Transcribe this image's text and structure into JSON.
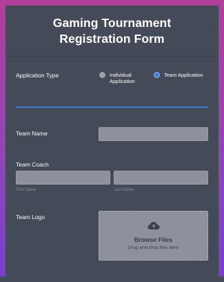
{
  "form": {
    "title": "Gaming Tournament Registration Form"
  },
  "application_type": {
    "label": "Application Type",
    "options": [
      {
        "label": "Individual Application",
        "selected": false
      },
      {
        "label": "Team Application",
        "selected": true
      }
    ]
  },
  "team_name": {
    "label": "Team Name",
    "value": ""
  },
  "team_coach": {
    "label": "Team Coach",
    "first_sublabel": "First Name",
    "last_sublabel": "Last Name",
    "first_value": "",
    "last_value": ""
  },
  "team_logo": {
    "label": "Team Logo",
    "icon": "cloud-upload-icon",
    "button_title": "Browse Files",
    "button_sub": "Drag and drop files here"
  },
  "colors": {
    "accent": "#3b7ddb",
    "panel": "#454a58",
    "frame_top": "#b13e99",
    "frame_bottom": "#7a3fcf"
  }
}
